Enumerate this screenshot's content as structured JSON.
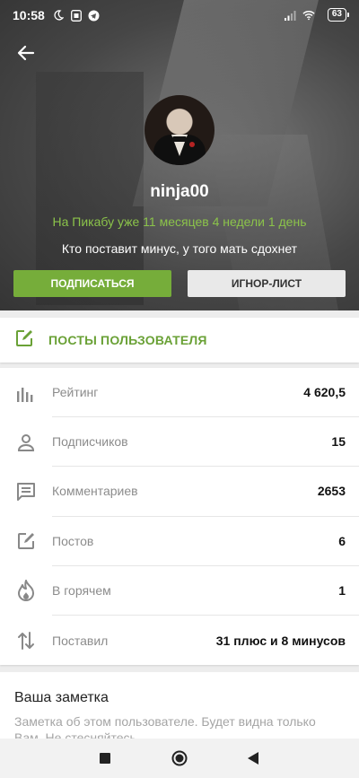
{
  "status_bar": {
    "time": "10:58",
    "battery": "63",
    "icons": [
      "moon-icon",
      "app-notification-icon",
      "telegram-icon",
      "signal-icon",
      "wifi-icon",
      "battery-icon"
    ]
  },
  "profile": {
    "username": "ninja00",
    "since": "На Пикабу уже 11 месяцев 4 недели 1 день",
    "motto": "Кто поставит минус, у того мать сдохнет",
    "subscribe_label": "ПОДПИСАТЬСЯ",
    "ignore_label": "ИГНОР-ЛИСТ"
  },
  "posts_link": {
    "label": "ПОСТЫ ПОЛЬЗОВАТЕЛЯ",
    "icon": "edit-icon"
  },
  "stats": [
    {
      "icon": "bar-chart-icon",
      "label": "Рейтинг",
      "value": "4 620,5"
    },
    {
      "icon": "person-icon",
      "label": "Подписчиков",
      "value": "15"
    },
    {
      "icon": "comment-icon",
      "label": "Комментариев",
      "value": "2653"
    },
    {
      "icon": "edit-icon",
      "label": "Постов",
      "value": "6"
    },
    {
      "icon": "flame-icon",
      "label": "В горячем",
      "value": "1"
    },
    {
      "icon": "swap-vertical-icon",
      "label": "Поставил",
      "value": "31 плюс и 8 минусов"
    }
  ],
  "note": {
    "title": "Ваша заметка",
    "hint": "Заметка об этом пользователе. Будет видна только Вам. Не стесняйтесь"
  },
  "colors": {
    "accent_green": "#76ad3a",
    "text_green": "#8bc34a",
    "ignore_bg": "#e9e9e9"
  }
}
